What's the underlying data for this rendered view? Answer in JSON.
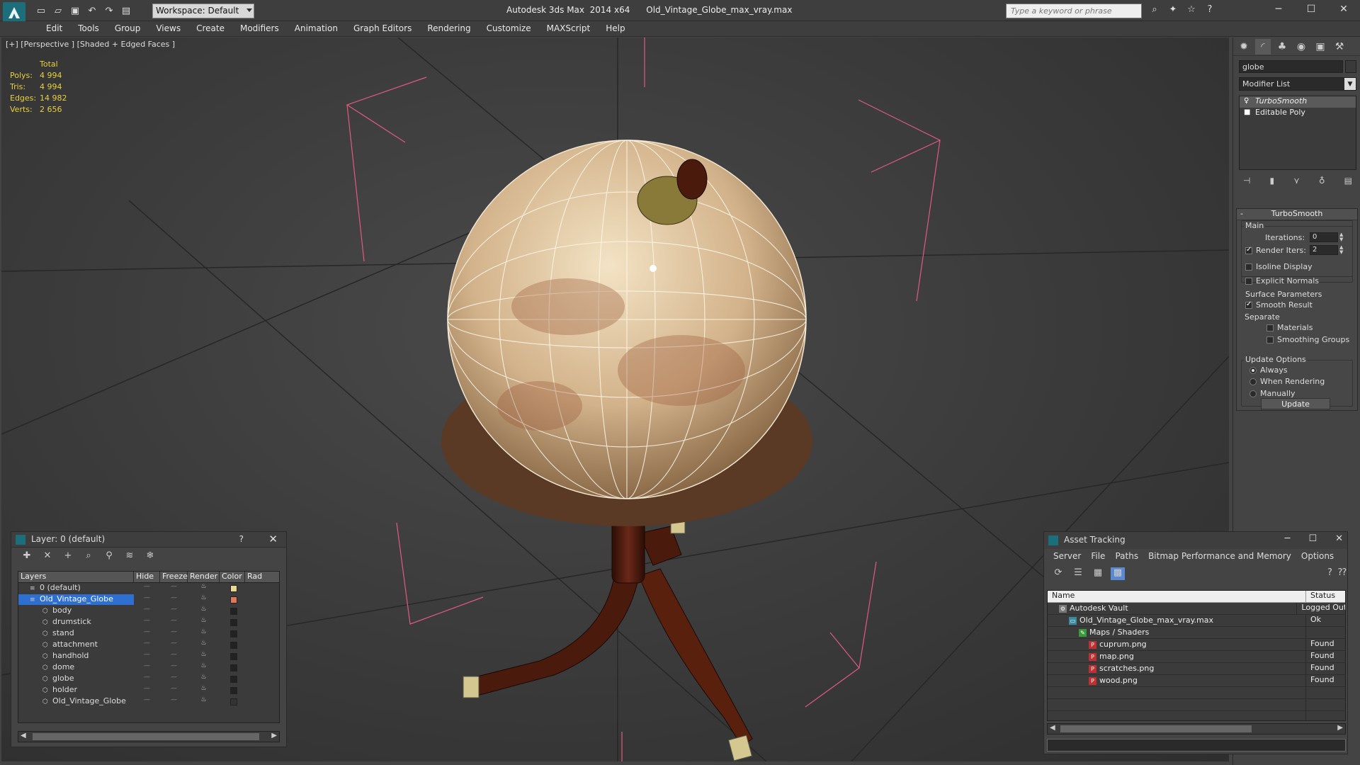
{
  "app": {
    "title": "Autodesk 3ds Max  2014 x64      Old_Vintage_Globe_max_vray.max",
    "workspace": "Workspace: Default",
    "search_placeholder": "Type a keyword or phrase"
  },
  "menu": [
    "Edit",
    "Tools",
    "Group",
    "Views",
    "Create",
    "Modifiers",
    "Animation",
    "Graph Editors",
    "Rendering",
    "Customize",
    "MAXScript",
    "Help"
  ],
  "viewport": {
    "label": "[+] [Perspective ] [Shaded + Edged Faces ]",
    "stats": {
      "header": "Total",
      "rows": [
        {
          "k": "Polys:",
          "v": "4 994"
        },
        {
          "k": "Tris:",
          "v": "4 994"
        },
        {
          "k": "Edges:",
          "v": "14 982"
        },
        {
          "k": "Verts:",
          "v": "2 656"
        }
      ]
    }
  },
  "command_panel": {
    "object_name": "globe",
    "modifier_list": "Modifier List",
    "stack": [
      "TurboSmooth",
      "Editable Poly"
    ],
    "turbosmooth": {
      "title": "TurboSmooth",
      "main": "Main",
      "iterations_label": "Iterations:",
      "iterations": "0",
      "render_iters_label": "Render Iters:",
      "render_iters": "2",
      "isoline": "Isoline Display",
      "explicit": "Explicit Normals",
      "surface": "Surface Parameters",
      "smooth_result": "Smooth Result",
      "separate": "Separate",
      "materials": "Materials",
      "smoothing_groups": "Smoothing Groups",
      "update_options": "Update Options",
      "always": "Always",
      "when_rendering": "When Rendering",
      "manually": "Manually",
      "update": "Update"
    }
  },
  "layer_window": {
    "title": "Layer: 0 (default)",
    "help": "?",
    "columns": [
      "Layers",
      "Hide",
      "Freeze",
      "Render",
      "Color",
      "Rad"
    ],
    "rows": [
      {
        "name": "0 (default)",
        "type": "layer",
        "color": "#e8d890"
      },
      {
        "name": "Old_Vintage_Globe",
        "type": "layer",
        "color": "#e07858",
        "selected": true
      },
      {
        "name": "body",
        "type": "child",
        "color": "#222222"
      },
      {
        "name": "drumstick",
        "type": "child",
        "color": "#222222"
      },
      {
        "name": "stand",
        "type": "child",
        "color": "#222222"
      },
      {
        "name": "attachment",
        "type": "child",
        "color": "#222222"
      },
      {
        "name": "handhold",
        "type": "child",
        "color": "#222222"
      },
      {
        "name": "dome",
        "type": "child",
        "color": "#222222"
      },
      {
        "name": "globe",
        "type": "child",
        "color": "#222222"
      },
      {
        "name": "holder",
        "type": "child",
        "color": "#222222"
      },
      {
        "name": "Old_Vintage_Globe",
        "type": "child",
        "color": "#333333"
      }
    ]
  },
  "asset_window": {
    "title": "Asset Tracking",
    "menu": [
      "Server",
      "File",
      "Paths",
      "Bitmap Performance and Memory",
      "Options"
    ],
    "columns": [
      "Name",
      "Status"
    ],
    "rows": [
      {
        "name": "Autodesk Vault",
        "status": "Logged Out",
        "indent": 0,
        "icon": "vault"
      },
      {
        "name": "Old_Vintage_Globe_max_vray.max",
        "status": "Ok",
        "indent": 1,
        "icon": "max"
      },
      {
        "name": "Maps / Shaders",
        "status": "",
        "indent": 2,
        "icon": "maps"
      },
      {
        "name": "cuprum.png",
        "status": "Found",
        "indent": 3,
        "icon": "png"
      },
      {
        "name": "map.png",
        "status": "Found",
        "indent": 3,
        "icon": "png"
      },
      {
        "name": "scratches.png",
        "status": "Found",
        "indent": 3,
        "icon": "png"
      },
      {
        "name": "wood.png",
        "status": "Found",
        "indent": 3,
        "icon": "png"
      }
    ]
  }
}
